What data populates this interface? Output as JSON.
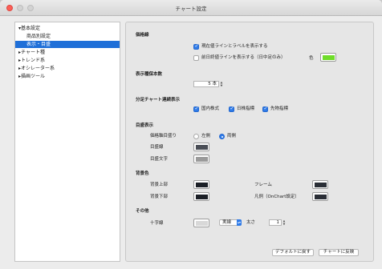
{
  "window": {
    "title": "チャート設定"
  },
  "sidebar": {
    "items": [
      {
        "label": "▾基本設定"
      },
      {
        "label": "商品別設定"
      },
      {
        "label": "表示・目盛"
      },
      {
        "label": "▸チャート種"
      },
      {
        "label": "▸トレンド系"
      },
      {
        "label": "▸オシレーター系"
      },
      {
        "label": "▸描画ツール"
      }
    ],
    "selected_index": 2
  },
  "price_line": {
    "heading": "価格線",
    "show_current_label": "現在値ラインとラベルを表示する",
    "show_current_checked": true,
    "show_prev_label": "前日終値ラインを表示する（日中足のみ）",
    "show_prev_checked": false,
    "color_label": "色",
    "color": "#6fdc2a"
  },
  "bars": {
    "heading": "表示種保本数",
    "value": "5 本"
  },
  "intraday": {
    "heading": "分足チャート連続表示",
    "options": [
      {
        "label": "国内株式",
        "checked": true
      },
      {
        "label": "日株指標",
        "checked": true
      },
      {
        "label": "先物指標",
        "checked": true
      }
    ]
  },
  "scale": {
    "heading": "目盛表示",
    "price_label": "価格軸目盛り",
    "left_label": "左側",
    "right_label": "両側",
    "selected": "両側",
    "grid_label": "目盛線",
    "grid_color": "#4a4e56",
    "text_label": "目盛文字",
    "text_color": "#9a9a9a"
  },
  "background": {
    "heading": "背景色",
    "top_label": "背景上部",
    "top_color": "#1b1f26",
    "bottom_label": "背景下部",
    "bottom_color": "#1b1f26",
    "frame_label": "フレーム",
    "frame_color": "#2a2e36",
    "legend_label": "凡例（OnChart設定）",
    "legend_color": "#2a2e36"
  },
  "other": {
    "heading": "その他",
    "crosshair_label": "十字線",
    "crosshair_color": "#d8d8d8",
    "style_value": "実線",
    "width_label": "太さ",
    "width_value": "1"
  },
  "buttons": {
    "default_label": "デフォルトに戻す",
    "apply_label": "チャートに反映"
  },
  "colors": {
    "selection": "#1f6fd8",
    "accent": "#2f7be8"
  }
}
